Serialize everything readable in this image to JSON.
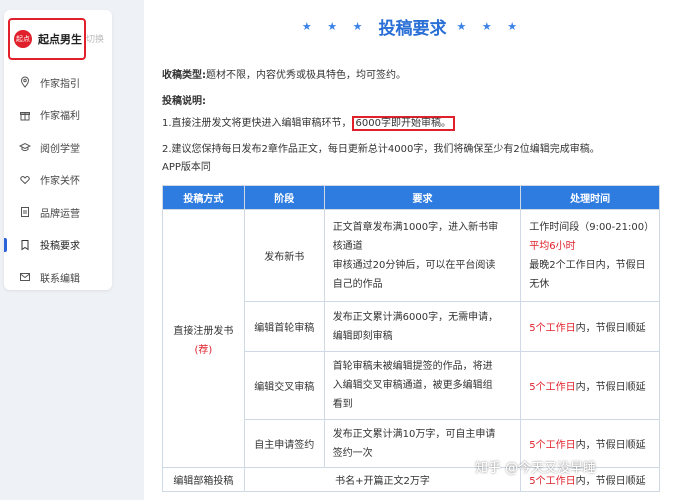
{
  "sidebar": {
    "brand_logo": "起点",
    "brand_name": "起点男生",
    "brand_switch": "切换",
    "items": [
      {
        "label": "作家指引",
        "icon": "location-pin-icon"
      },
      {
        "label": "作家福利",
        "icon": "gift-icon"
      },
      {
        "label": "阅创学堂",
        "icon": "graduation-cap-icon"
      },
      {
        "label": "作家关怀",
        "icon": "heart-hands-icon"
      },
      {
        "label": "品牌运营",
        "icon": "document-icon"
      },
      {
        "label": "投稿要求",
        "icon": "bookmark-icon"
      },
      {
        "label": "联系编辑",
        "icon": "mail-icon"
      }
    ],
    "active_index": 5
  },
  "page": {
    "stars_left": "★ ★ ★",
    "title": "投稿要求",
    "stars_right": "★ ★ ★",
    "topics_label": "收稿类型:",
    "topics_text": "题材不限，内容优秀或极具特色，均可签约。",
    "instr_label": "投稿说明:",
    "line1_a": "1.直接注册发文将更快进入编辑审稿环节，",
    "line1_highlight": "6000字即开始审稿。",
    "line2": "2.建议您保持每日发布2章作品正文，每日更新总计4000字，我们将确保至少有2位编辑完成审稿。",
    "line3": "APP版本同"
  },
  "table": {
    "headers": [
      "投稿方式",
      "阶段",
      "要求",
      "处理时间"
    ],
    "method1": "直接注册发书",
    "method1_tag": "(荐)",
    "method2": "编辑部箱投稿",
    "rows": [
      {
        "stage": "发布新书",
        "req": [
          "正文首章发布满1000字，进入新书审",
          "核通道",
          "审核通过20分钟后，可以在平台阅读",
          "自己的作品"
        ],
        "time_lines": [
          {
            "text": "工作时间段（9:00-21:00）",
            "red": false
          },
          {
            "text": "平均6小时",
            "red": true
          },
          {
            "text": "最晚2个工作日内，节假日",
            "red": false
          },
          {
            "text": "无休",
            "red": false
          }
        ]
      },
      {
        "stage": "编辑首轮审稿",
        "req": [
          "发布正文累计满6000字，无需申请，",
          "编辑即刻审稿"
        ],
        "time_red": "5个工作日",
        "time_rest": "内，节假日顺延"
      },
      {
        "stage": "编辑交叉审稿",
        "req": [
          "首轮审稿未被编辑提签的作品，将进",
          "入编辑交叉审稿通道，被更多编辑组",
          "看到"
        ],
        "time_red": "5个工作日",
        "time_rest": "内，节假日顺延"
      },
      {
        "stage": "自主申请签约",
        "req": [
          "发布正文累计满10万字，可自主申请",
          "签约一次"
        ],
        "time_red": "5个工作日",
        "time_rest": "内，节假日顺延"
      },
      {
        "stage": "",
        "req": [
          "书名+开篇正文2万字"
        ],
        "time_red": "5个工作日",
        "time_rest": "内，节假日顺延"
      }
    ]
  },
  "watermark": "知乎 @今天又没早睡",
  "colors": {
    "accent_blue": "#2f7ce0",
    "highlight_red": "#e0202a"
  }
}
